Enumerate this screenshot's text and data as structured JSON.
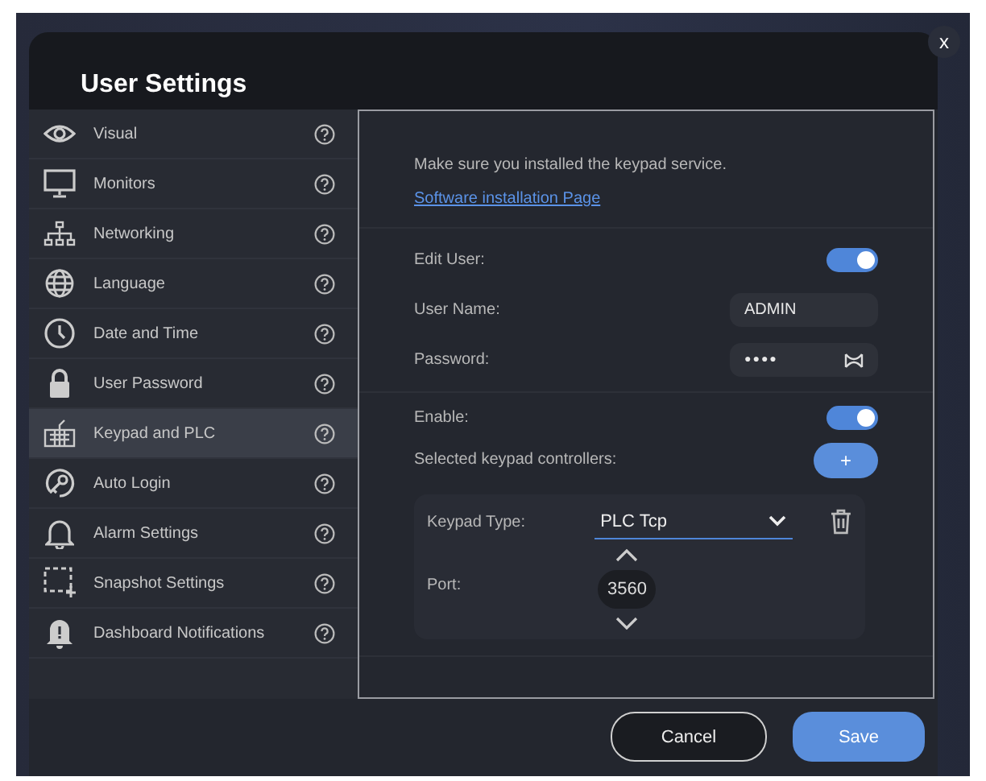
{
  "dialog": {
    "title": "User Settings",
    "close": "x"
  },
  "sidebar": {
    "items": [
      {
        "label": "Visual",
        "selected": false
      },
      {
        "label": "Monitors",
        "selected": false
      },
      {
        "label": "Networking",
        "selected": false
      },
      {
        "label": "Language",
        "selected": false
      },
      {
        "label": "Date and Time",
        "selected": false
      },
      {
        "label": "User Password",
        "selected": false
      },
      {
        "label": "Keypad and PLC",
        "selected": true
      },
      {
        "label": "Auto Login",
        "selected": false
      },
      {
        "label": "Alarm Settings",
        "selected": false
      },
      {
        "label": "Snapshot Settings",
        "selected": false
      },
      {
        "label": "Dashboard Notifications",
        "selected": false
      }
    ]
  },
  "content": {
    "notice": "Make sure you installed the keypad service.",
    "link": "Software installation Page",
    "edit_user": {
      "label": "Edit User:",
      "on": true
    },
    "user_name": {
      "label": "User Name:",
      "value": "ADMIN"
    },
    "password": {
      "label": "Password:",
      "value": "●●●●"
    },
    "enable": {
      "label": "Enable:",
      "on": true
    },
    "controllers": {
      "label": "Selected keypad controllers:",
      "add": "+"
    },
    "controller": {
      "type_label": "Keypad Type:",
      "type_value": "PLC Tcp",
      "port_label": "Port:",
      "port_value": "3560"
    }
  },
  "buttons": {
    "cancel": "Cancel",
    "save": "Save"
  }
}
